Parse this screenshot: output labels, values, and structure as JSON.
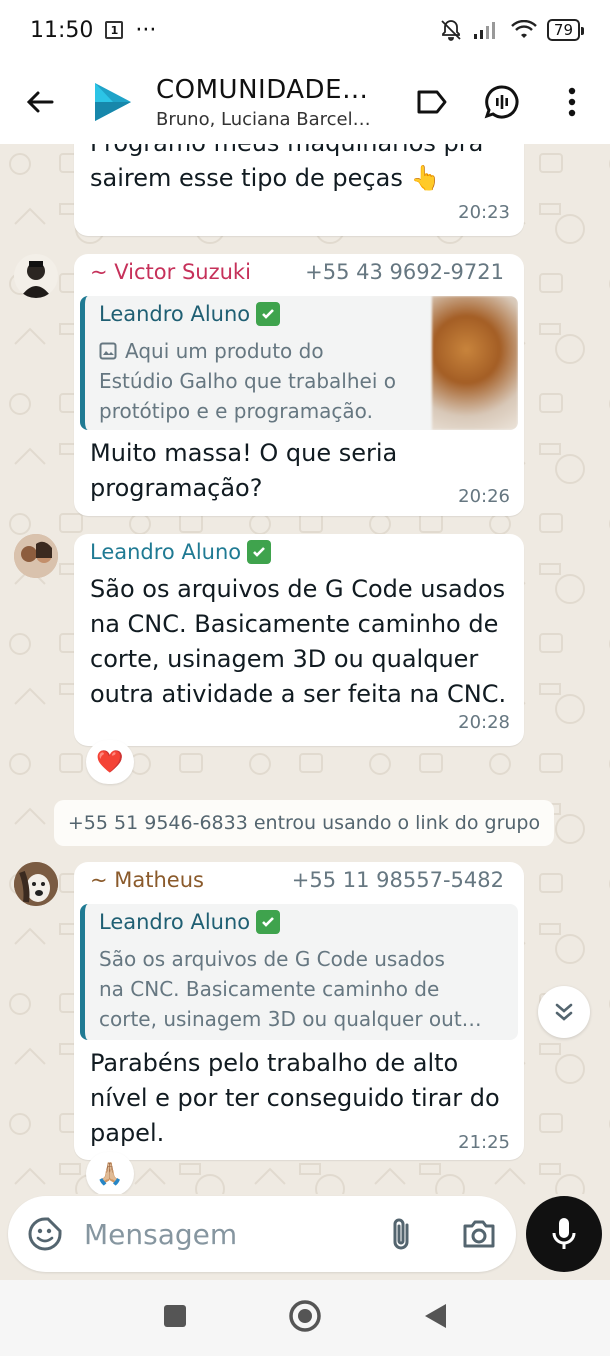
{
  "status_bar": {
    "time": "11:50",
    "dots": "···",
    "battery": "79"
  },
  "header": {
    "title": "COMUNIDADE…",
    "subtitle": "Bruno, Luciana Barcel…",
    "accent": "#1fa3c8"
  },
  "messages": [
    {
      "text_top_cut": "Programo meus maquinários pra",
      "text": "sairem esse tipo de peças 👆",
      "time": "20:23"
    },
    {
      "sender": "~ Victor Suzuki",
      "phone": "+55 43 9692-9721",
      "quote_author": "Leandro Aluno",
      "quote_lines": [
        "Aqui um produto do",
        "Estúdio Galho que trabalhei o",
        "protótipo e e programação."
      ],
      "text_lines": [
        "Muito massa! O que seria",
        "programação?"
      ],
      "time": "20:26"
    },
    {
      "sender": "Leandro Aluno",
      "text_lines": [
        "São os arquivos de G Code usados",
        "na CNC. Basicamente caminho de",
        "corte, usinagem 3D ou qualquer",
        "outra atividade a ser feita na CNC."
      ],
      "time": "20:28",
      "reaction": "❤️"
    },
    {
      "system": "+55 51 9546-6833 entrou usando o link do grupo"
    },
    {
      "sender": "~ Matheus",
      "phone": "+55 11 98557-5482",
      "quote_author": "Leandro Aluno",
      "quote_lines": [
        "São os arquivos de G Code usados",
        "na CNC. Basicamente caminho de",
        "corte, usinagem 3D ou qualquer out…"
      ],
      "text_lines": [
        "Parabéns pelo trabalho de alto",
        "nível e por ter conseguido tirar do",
        "papel."
      ],
      "time": "21:25",
      "reaction": "🙏🏼"
    }
  ],
  "composer": {
    "placeholder": "Mensagem"
  },
  "colors": {
    "chat_bg": "#efeae2",
    "bubble": "#ffffff",
    "quote_bar": "#1f7a93",
    "sender_pink": "#c6315a",
    "sender_teal": "#1f7a93",
    "sender_brown": "#8a5a2b"
  },
  "icons": {
    "back": "arrow-left-icon",
    "label": "label-tag-icon",
    "call": "group-call-icon",
    "menu": "more-vert-icon",
    "emoji": "sticker-emoji-icon",
    "attach": "paperclip-icon",
    "camera": "camera-icon",
    "mic": "mic-icon",
    "scroll": "double-chevron-down-icon"
  }
}
